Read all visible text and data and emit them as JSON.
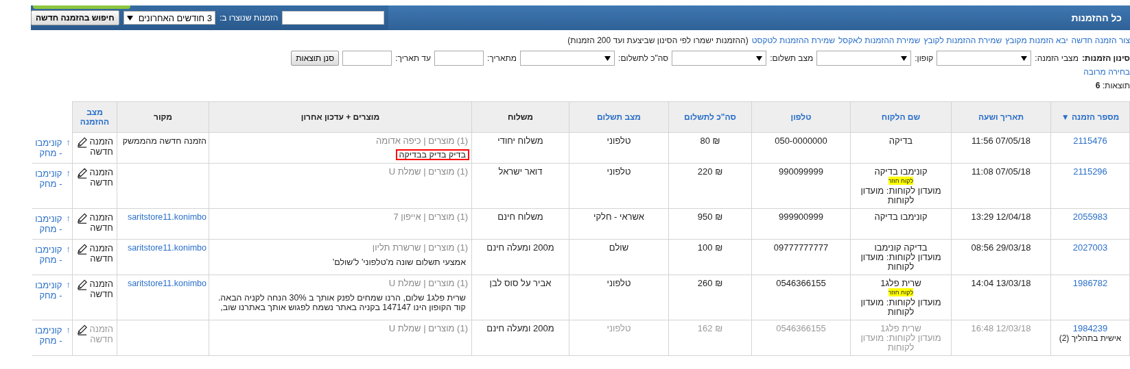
{
  "header": {
    "title": "כל ההזמנות",
    "search": {
      "label": "הזמנות שנוצרו ב:",
      "range": "3 חודשים האחרונים",
      "button": "חיפוש בהזמנה חדשה"
    }
  },
  "links": [
    "צור הזמנה חדשה",
    "יבא הזמנות מקובץ",
    "שמירת ההזמנות לקובץ",
    "שמירת ההזמנות לאקסל",
    "שמירת ההזמנות לטקסט"
  ],
  "links_note": "(ההזמנות ישמרו לפי הסינון שביצעת ועד 200 הזמנות)",
  "filters": {
    "title": "סינון הזמנות:",
    "multi_select": "בחירה מרובה",
    "button": "סנן תוצאות",
    "fields": [
      {
        "kind": "select",
        "label": "מצבי הזמנה:"
      },
      {
        "kind": "select",
        "label": "קופון:"
      },
      {
        "kind": "select",
        "label": "מצב תשלום:"
      },
      {
        "kind": "select",
        "label": "סה\"כ לתשלום:"
      },
      {
        "kind": "input",
        "label": "מתאריך:"
      },
      {
        "kind": "input",
        "label": "עד תאריך:"
      }
    ]
  },
  "results": {
    "label": "תוצאות:",
    "count": "6"
  },
  "table": {
    "columns": [
      {
        "label": "מספר הזמנה",
        "kind": "link",
        "sort": "▼"
      },
      {
        "label": "תאריך ושעה",
        "kind": "link"
      },
      {
        "label": "שם הלקוח",
        "kind": "link"
      },
      {
        "label": "טלפון",
        "kind": "link"
      },
      {
        "label": "סה\"כ לתשלום",
        "kind": "link"
      },
      {
        "label": "מצב תשלום",
        "kind": "link"
      },
      {
        "label": "משלוח",
        "kind": "plain"
      },
      {
        "label": "מוצרים + עדכון אחרון",
        "kind": "plain"
      },
      {
        "label": "מקור",
        "kind": "plain"
      },
      {
        "label": "מצב ההזמנה",
        "kind": "link"
      }
    ],
    "rows": [
      {
        "disabled": false,
        "order": {
          "number": "2115476"
        },
        "date": "07/05/18 11:56",
        "customer": {
          "name": "בדיקה"
        },
        "phone": "050-0000000",
        "total": "80 ₪",
        "payment": "טלפוני",
        "shipping": "משלוח יחודי",
        "products": {
          "summary": "(1) מוצרים | כיפה אדומה",
          "note": "בדיק בדיק בבדיקה",
          "highlighted": true
        },
        "source": {
          "kind": "plain",
          "text": "הזמנה חדשה מהממשק"
        },
        "status": "הזמנה חדשה",
        "action": {
          "arrow": "↑",
          "link": "קונימבו - מחק"
        }
      },
      {
        "disabled": false,
        "order": {
          "number": "2115296"
        },
        "date": "07/05/18 11:08",
        "customer": {
          "name": "קונימבו בדיקה",
          "badge": "לקוח חוזר",
          "club": "מועדון לקוחות: מועדון לקוחות"
        },
        "phone": "990099999",
        "total": "220 ₪",
        "payment": "טלפוני",
        "shipping": "דואר ישראל",
        "products": {
          "summary": "(1) מוצרים | שמלת U"
        },
        "status": "הזמנה חדשה",
        "action": {
          "arrow": "↑",
          "link": "קונימבו - מחק"
        }
      },
      {
        "disabled": false,
        "order": {
          "number": "2055983"
        },
        "date": "12/04/18 13:29",
        "customer": {
          "name": "קונימבו בדיקה"
        },
        "phone": "999900999",
        "total": "950 ₪",
        "payment": "אשראי - חלקי",
        "shipping": "משלוח חינם",
        "products": {
          "summary": "(1) מוצרים | אייפון 7"
        },
        "source": {
          "kind": "link",
          "text": "saritstore11.konimbo"
        },
        "status": "הזמנה חדשה",
        "action": {
          "arrow": "↑",
          "link": "קונימבו - מחק"
        }
      },
      {
        "disabled": false,
        "order": {
          "number": "2027003"
        },
        "date": "29/03/18 08:56",
        "customer": {
          "name": "בדיקה קונימבו",
          "club": "מועדון לקוחות: מועדון לקוחות"
        },
        "phone": "09777777777",
        "total": "100 ₪",
        "payment": "שולם",
        "shipping": "מ200 ומעלה חינם",
        "products": {
          "summary": "(1) מוצרים | שרשרת תליון",
          "note": "אמצעי תשלום שונה מ'טלפוני' ל'שולם'",
          "highlighted": false
        },
        "source": {
          "kind": "link",
          "text": "saritstore11.konimbo"
        },
        "status": "הזמנה חדשה",
        "action": {
          "arrow": "↑",
          "link": "קונימבו - מחק"
        }
      },
      {
        "disabled": false,
        "order": {
          "number": "1986782"
        },
        "date": "13/03/18 14:04",
        "customer": {
          "name": "שרית פלג1",
          "badge": "לקוח חוזר",
          "club": "מועדון לקוחות: מועדון לקוחות"
        },
        "phone": "0546366155",
        "total": "260 ₪",
        "payment": "טלפוני",
        "shipping": "אביר על סוס לבן",
        "products": {
          "summary": "(1) מוצרים | שמלת U",
          "note": "שרית פלג1 שלום, הרנו שמחים לפנק אותך ב 30% הנחה לקניה הבאה. קוד הקופון הינו 147147 בקניה באתר נשמח לפגוש אותך באתרנו שוב,",
          "highlighted": false
        },
        "source": {
          "kind": "link",
          "text": "saritstore11.konimbo"
        },
        "status": "הזמנה חדשה",
        "action": {
          "arrow": "↑",
          "link": "קונימבו - מחק"
        }
      },
      {
        "disabled": true,
        "order": {
          "number": "1984239",
          "sub": "אישית בתהליך (2)"
        },
        "date": "12/03/18 16:48",
        "customer": {
          "name": "שרית פלג1",
          "club": "מועדון לקוחות: מועדון לקוחות"
        },
        "phone": "0546366155",
        "total": "162 ₪",
        "payment": "טלפוני",
        "shipping": "מ200 ומעלה חינם",
        "products": {
          "summary": "(1) מוצרים | שמלת U"
        },
        "status": "הזמנה חדשה",
        "action": {
          "arrow": "↑",
          "link": "קונימבו - מחק"
        }
      }
    ]
  }
}
